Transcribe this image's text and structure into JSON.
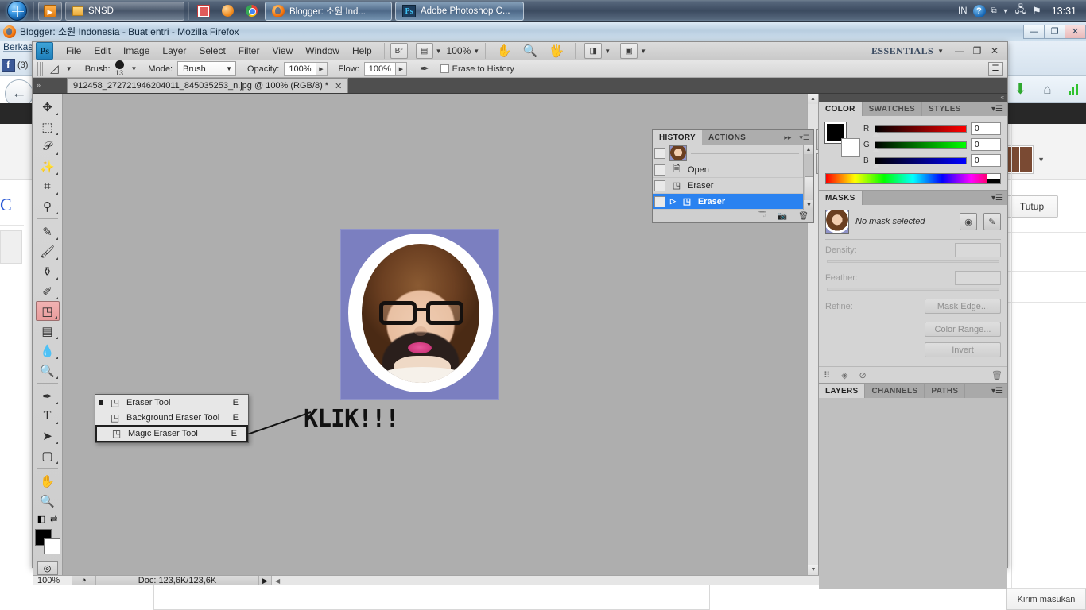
{
  "taskbar": {
    "start_icon": "windows-orb-icon",
    "items": [
      {
        "icon": "media-player-icon",
        "label": ""
      },
      {
        "icon": "folder-icon",
        "label": "SNSD"
      },
      {
        "icon": "picture-icon",
        "label": ""
      },
      {
        "icon": "orange-ball-icon",
        "label": ""
      },
      {
        "icon": "chrome-icon",
        "label": ""
      },
      {
        "icon": "firefox-icon",
        "label": "Blogger: 소원 Ind..."
      },
      {
        "icon": "photoshop-icon",
        "label": "Adobe Photoshop C..."
      }
    ],
    "tray": {
      "language": "IN",
      "help_icon": "help-icon",
      "network_icon": "network-icon",
      "action_center_icon": "flag-icon",
      "clock": "13:31"
    }
  },
  "firefox_window": {
    "icon": "firefox-icon",
    "title": "Blogger: 소원 Indonesia - Buat entri - Mozilla Firefox",
    "buttons": {
      "minimize": "—",
      "maximize": "❐",
      "close": "✕"
    }
  },
  "background_page": {
    "menu_berkas": "Berkas",
    "facebook_badge": {
      "icon": "facebook-icon",
      "count": "(3)"
    },
    "back_button": "←",
    "nav_icons": [
      "download-arrow-icon",
      "home-icon",
      "stats-bars-icon"
    ],
    "tutup_button": "Tutup",
    "kirim_button": "Kirim masukan"
  },
  "photoshop": {
    "logo": "Ps",
    "menu": [
      "File",
      "Edit",
      "Image",
      "Layer",
      "Select",
      "Filter",
      "View",
      "Window",
      "Help"
    ],
    "bridge_button": "Br",
    "view_extras_icon": "view-extras-icon",
    "zoom_level": "100%",
    "quick_tools": [
      "hand-tool-icon",
      "zoom-tool-icon",
      "rotate-view-icon"
    ],
    "arrange_icon": "arrange-documents-icon",
    "screen_mode_icon": "screen-mode-icon",
    "workspace": "ESSENTIALS",
    "window_buttons": {
      "minimize": "—",
      "maximize": "❐",
      "close": "✕"
    },
    "options_bar": {
      "tool_icon": "eraser-tool-icon",
      "brush_label": "Brush:",
      "brush_size": "13",
      "mode_label": "Mode:",
      "mode_value": "Brush",
      "opacity_label": "Opacity:",
      "opacity_value": "100%",
      "flow_label": "Flow:",
      "flow_value": "100%",
      "airbrush_icon": "airbrush-icon",
      "erase_to_history_label": "Erase to History",
      "erase_to_history_checked": false,
      "panel_toggle_icon": "panels-icon"
    },
    "document_tab": {
      "title": "912458_272721946204011_845035253_n.jpg @ 100% (RGB/8) *",
      "close": "✕"
    },
    "tools": [
      "move-tool-icon",
      "rectangular-marquee-tool-icon",
      "lasso-tool-icon",
      "magic-wand-tool-icon",
      "crop-tool-icon",
      "eyedropper-tool-icon",
      "spot-healing-brush-tool-icon",
      "brush-tool-icon",
      "clone-stamp-tool-icon",
      "history-brush-tool-icon",
      "eraser-tool-icon",
      "gradient-tool-icon",
      "blur-tool-icon",
      "dodge-tool-icon",
      "pen-tool-icon",
      "type-tool-icon",
      "path-selection-tool-icon",
      "rectangle-tool-icon",
      "hand-tool-icon",
      "zoom-tool-icon"
    ],
    "selected_tool": "eraser-tool-icon",
    "foreground_color": "#000000",
    "background_color": "#ffffff",
    "quick_mask_icon": "quick-mask-icon",
    "tool_flyout": {
      "items": [
        {
          "label": "Eraser Tool",
          "shortcut": "E",
          "icon": "eraser-tool-icon",
          "active": true,
          "highlighted": false
        },
        {
          "label": "Background Eraser Tool",
          "shortcut": "E",
          "icon": "background-eraser-tool-icon",
          "active": false,
          "highlighted": false
        },
        {
          "label": "Magic Eraser Tool",
          "shortcut": "E",
          "icon": "magic-eraser-tool-icon",
          "active": false,
          "highlighted": true
        }
      ]
    },
    "annotation": {
      "text": "KLIK!!!"
    },
    "history_panel": {
      "tabs": [
        "HISTORY",
        "ACTIONS"
      ],
      "active_tab": "HISTORY",
      "collapse_icon": "collapse-icon",
      "menu_icon": "panel-menu-icon",
      "snapshot_label": "",
      "items": [
        {
          "label": "Open",
          "icon": "open-document-icon",
          "selected": false
        },
        {
          "label": "Eraser",
          "icon": "eraser-tool-icon",
          "selected": false
        },
        {
          "label": "Eraser",
          "icon": "eraser-tool-icon",
          "selected": true
        }
      ],
      "footer_icons": [
        "new-document-from-state-icon",
        "new-snapshot-icon",
        "delete-icon"
      ],
      "side_buttons": [
        "history-panel-icon",
        "actions-play-icon"
      ]
    },
    "color_panel": {
      "tabs": [
        "COLOR",
        "SWATCHES",
        "STYLES"
      ],
      "active_tab": "COLOR",
      "menu_icon": "panel-menu-icon",
      "channels": [
        {
          "label": "R",
          "value": "0"
        },
        {
          "label": "G",
          "value": "0"
        },
        {
          "label": "B",
          "value": "0"
        }
      ]
    },
    "masks_panel": {
      "tabs": [
        "MASKS"
      ],
      "active_tab": "MASKS",
      "menu_icon": "panel-menu-icon",
      "status": "No mask selected",
      "add_pixel_mask_icon": "add-pixel-mask-icon",
      "add_vector_mask_icon": "add-vector-mask-icon",
      "density_label": "Density:",
      "density_value": "",
      "feather_label": "Feather:",
      "feather_value": "",
      "refine_label": "Refine:",
      "buttons": [
        "Mask Edge...",
        "Color Range...",
        "Invert"
      ],
      "footer_icons": [
        "load-selection-icon",
        "apply-mask-icon",
        "disable-mask-icon",
        "delete-mask-icon"
      ]
    },
    "layers_panel": {
      "tabs": [
        "LAYERS",
        "CHANNELS",
        "PATHS"
      ],
      "active_tab": "LAYERS",
      "menu_icon": "panel-menu-icon"
    },
    "status_bar": {
      "zoom": "100%",
      "preview_icon": "preview-icon",
      "doc_info": "Doc: 123,6K/123,6K",
      "expand_arrow": "▶"
    }
  },
  "artwork": {
    "background_color": "#7b7fc0",
    "frame_color": "#ffffff",
    "description": "portrait-photo"
  }
}
